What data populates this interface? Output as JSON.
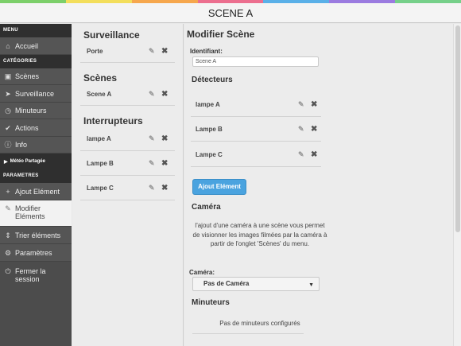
{
  "colors": {
    "stripe": [
      "#7ccf6a",
      "#f3de5b",
      "#f6a74d",
      "#ec6f8f",
      "#5ab0e8",
      "#9b7be0",
      "#76d08a"
    ],
    "accent": "#4aa3df",
    "sidebar_bg": "#4c4c4c"
  },
  "header": {
    "title": "SCENE A"
  },
  "sidebar": {
    "menu_head": "MENU",
    "home": {
      "label": "Accueil",
      "icon": "home-icon"
    },
    "categories_head": "CATÉGORIES",
    "categories": [
      {
        "label": "Scènes",
        "icon": "image-icon"
      },
      {
        "label": "Surveillance",
        "icon": "run-icon"
      },
      {
        "label": "Minuteurs",
        "icon": "clock-icon"
      },
      {
        "label": "Actions",
        "icon": "check-icon"
      },
      {
        "label": "Info",
        "icon": "info-icon"
      }
    ],
    "meteo": "Météo Partagée",
    "params_head": "PARAMETRES",
    "params": [
      {
        "label": "Ajout Elément",
        "icon": "plus-icon"
      },
      {
        "label": "Modifier Eléments",
        "icon": "pencil-icon"
      },
      {
        "label": "Trier éléments",
        "icon": "sort-icon"
      },
      {
        "label": "Paramètres",
        "icon": "gears-icon"
      },
      {
        "label": "Fermer la session",
        "icon": "power-icon"
      }
    ]
  },
  "list": {
    "surveillance_title": "Surveillance",
    "surveillance_items": [
      "Porte"
    ],
    "scenes_title": "Scènes",
    "scenes_items": [
      "Scene A"
    ],
    "interrupteurs_title": "Interrupteurs",
    "interrupteurs_items": [
      "lampe A",
      "Lampe B",
      "Lampe C"
    ]
  },
  "editor": {
    "title": "Modifier Scène",
    "id_label": "Identifiant:",
    "id_value": "Scene A",
    "detectors_title": "Détecteurs",
    "detectors": [
      "lampe A",
      "Lampe B",
      "Lampe C"
    ],
    "add_button": "Ajout Elément",
    "camera_title": "Caméra",
    "camera_text": "l'ajout d'une caméra à une scène vous permet de visionner les images filmées par la caméra à partir de l'onglet 'Scènes' du menu.",
    "camera_label": "Caméra:",
    "camera_select": "Pas de Caméra",
    "timers_title": "Minuteurs",
    "timers_empty": "Pas de minuteurs configurés"
  }
}
